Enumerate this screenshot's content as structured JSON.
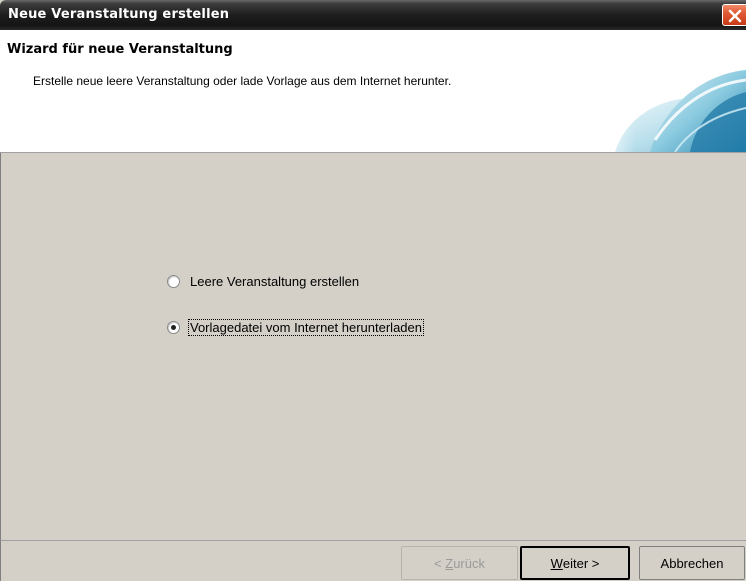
{
  "window": {
    "title": "Neue Veranstaltung erstellen"
  },
  "header": {
    "title": "Wizard für neue Veranstaltung",
    "subtitle": "Erstelle neue leere Veranstaltung oder lade Vorlage aus dem Internet herunter."
  },
  "options": [
    {
      "label": "Leere Veranstaltung erstellen",
      "checked": false
    },
    {
      "label": "Vorlagedatei vom Internet herunterladen",
      "checked": true
    }
  ],
  "buttons": {
    "back": {
      "prefix": "< ",
      "mnemonic": "Z",
      "rest": "urück",
      "enabled": false
    },
    "next": {
      "mnemonic": "W",
      "rest": "eiter >",
      "enabled": true
    },
    "cancel": {
      "label": "Abbrechen",
      "enabled": true
    }
  },
  "icons": {
    "close": "close-icon",
    "header_image": "wave-image"
  },
  "colors": {
    "close_button": "#e05a35",
    "titlebar": "#1e1e1e",
    "dialog_background": "#d4d0c8",
    "header_background": "#ffffff"
  }
}
